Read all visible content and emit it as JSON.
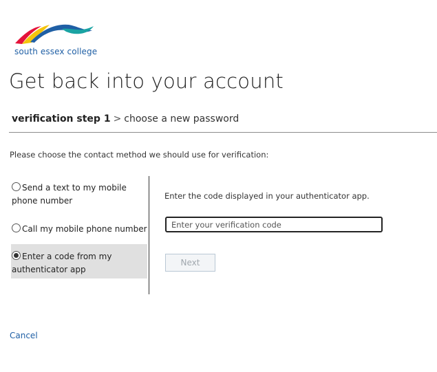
{
  "branding": {
    "logo_text": "south essex college",
    "colors": {
      "blue": "#1f5fa5",
      "red": "#e4133a",
      "yellow": "#f4c40d",
      "teal": "#1aa3a3"
    }
  },
  "page": {
    "title": "Get back into your account"
  },
  "breadcrumb": {
    "current_step": "verification step 1",
    "separator": ">",
    "next_step": "choose a new password"
  },
  "instructions": "Please choose the contact method we should use for verification:",
  "methods": [
    {
      "label": "Send a text to my mobile phone number",
      "selected": false
    },
    {
      "label": "Call my mobile phone number",
      "selected": false
    },
    {
      "label": "Enter a code from my authenticator app",
      "selected": true
    }
  ],
  "authenticator": {
    "prompt": "Enter the code displayed in your authenticator app.",
    "code_placeholder": "Enter your verification code",
    "code_value": "",
    "next_label": "Next"
  },
  "cancel_label": "Cancel"
}
